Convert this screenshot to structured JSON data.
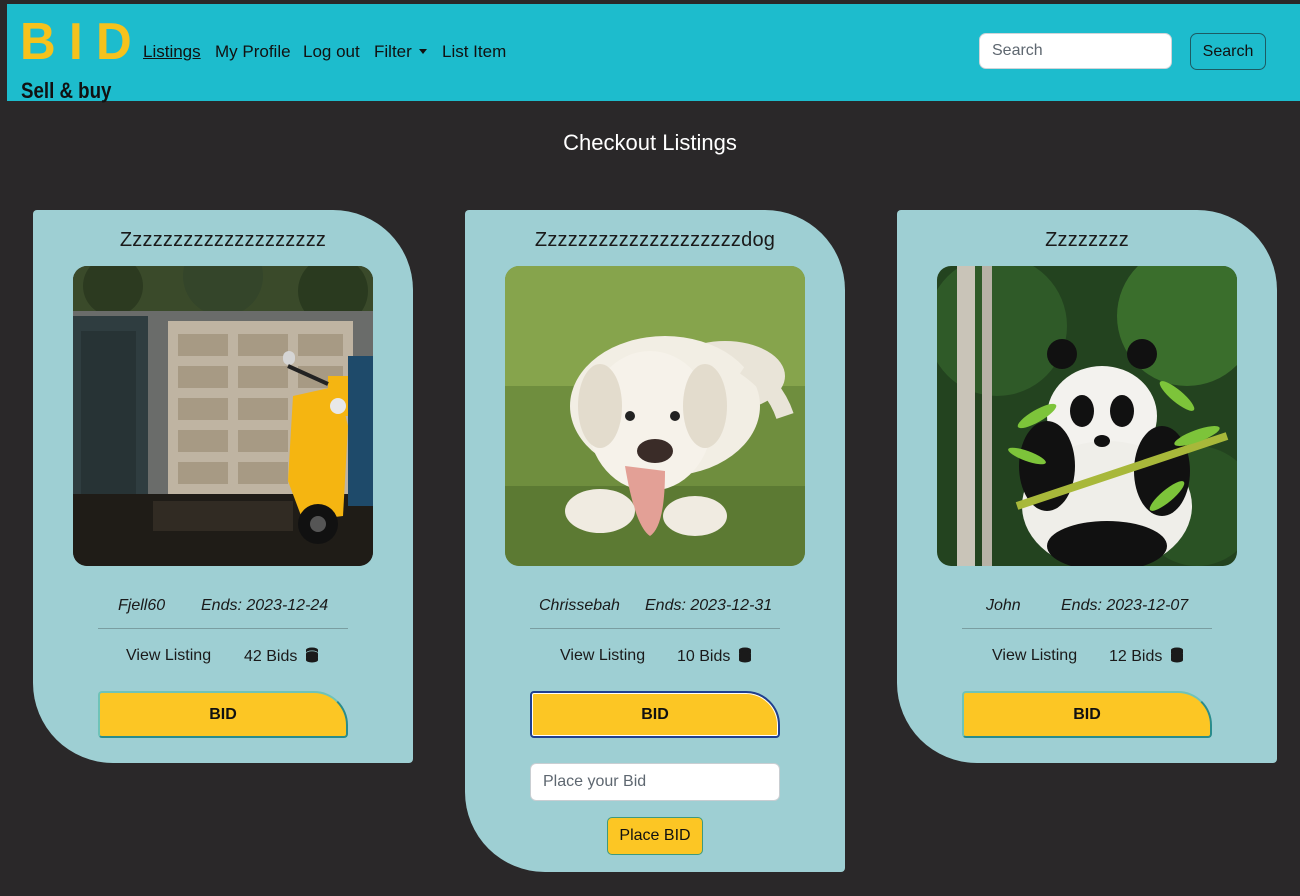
{
  "navbar": {
    "logo_big": "BID",
    "logo_small": "Sell & buy",
    "links": {
      "listings": "Listings",
      "my_profile": "My Profile",
      "log_out": "Log out",
      "filter": "Filter",
      "list_item": "List Item"
    },
    "search_placeholder": "Search",
    "search_button": "Search",
    "accent_color": "#1dbccd",
    "logo_color": "#f6c21c"
  },
  "page": {
    "title": "Checkout Listings",
    "background_color": "#2a2829"
  },
  "listings": [
    {
      "title": "Zzzzzzzzzzzzzzzzzzzz",
      "image": "yellow-scooter-garage",
      "seller": "Fjell60",
      "ends": "Ends: 2023-12-24",
      "view_label": "View Listing",
      "bids": "42 Bids",
      "bid_button": "BID"
    },
    {
      "title": "Zzzzzzzzzzzzzzzzzzzzdog",
      "image": "golden-retriever-on-grass",
      "seller": "Chrissebah",
      "ends": "Ends: 2023-12-31",
      "view_label": "View Listing",
      "bids": "10 Bids",
      "bid_button": "BID",
      "bid_placeholder": "Place your Bid",
      "place_bid_button": "Place BID"
    },
    {
      "title": "Zzzzzzzz",
      "image": "panda-eating-bamboo",
      "seller": "John",
      "ends": "Ends: 2023-12-07",
      "view_label": "View Listing",
      "bids": "12 Bids",
      "bid_button": "BID"
    }
  ],
  "colors": {
    "card": "#9ecfd3",
    "bid_button": "#fcc624"
  },
  "icons": {
    "coins": "coins-icon",
    "caret": "caret-down-icon"
  }
}
